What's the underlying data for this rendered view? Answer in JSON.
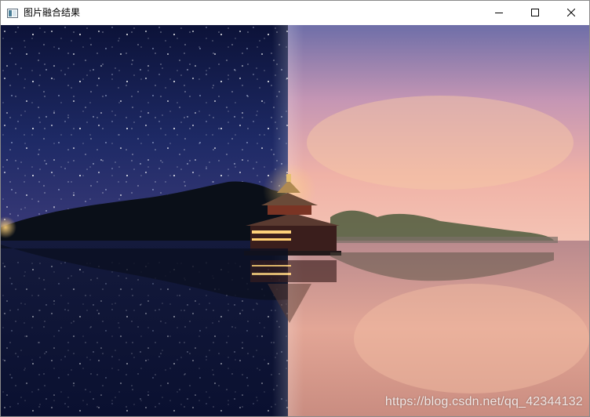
{
  "window": {
    "title": "图片融合结果",
    "app_icon": "opencv-window-icon",
    "controls": {
      "minimize_icon": "minimize-icon",
      "maximize_icon": "maximize-icon",
      "close_icon": "close-icon"
    }
  },
  "image": {
    "watermark": "https://blog.csdn.net/qq_42344132",
    "colors": {
      "night_sky_top": "#0c1238",
      "night_sky_bottom": "#3a3a78",
      "dusk_sky_top": "#6e6ea8",
      "dusk_sky_mid": "#f0b2a6",
      "dusk_sky_bottom": "#f4c3b4",
      "water_night": "#0a1030",
      "water_dusk": "#e3a696",
      "tower_light": "#ffd27a"
    }
  }
}
